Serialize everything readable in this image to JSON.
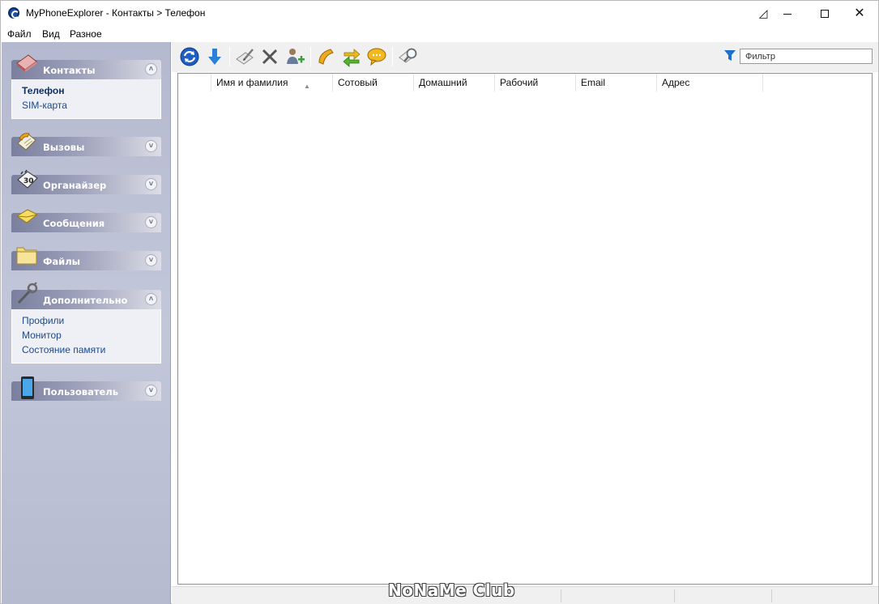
{
  "titlebar": {
    "title": "MyPhoneExplorer -  Контакты > Телефон",
    "minimize_icon": "minimize-icon",
    "maximize_icon": "maximize-icon",
    "close_icon": "close-icon"
  },
  "menu": {
    "items": [
      "Файл",
      "Вид",
      "Разное"
    ]
  },
  "sidebar": {
    "groups": [
      {
        "title": "Контакты",
        "icon": "address-book-icon",
        "expanded": true,
        "items": [
          "Телефон",
          "SIM-карта"
        ],
        "active": "Телефон"
      },
      {
        "title": "Вызовы",
        "icon": "call-log-icon",
        "expanded": false
      },
      {
        "title": "Органайзер",
        "icon": "organizer-icon",
        "expanded": false
      },
      {
        "title": "Сообщения",
        "icon": "messages-icon",
        "expanded": false
      },
      {
        "title": "Файлы",
        "icon": "folder-icon",
        "expanded": false
      },
      {
        "title": "Дополнительно",
        "icon": "tools-icon",
        "expanded": true,
        "items": [
          "Профили",
          "Монитор",
          "Состояние памяти"
        ]
      },
      {
        "title": "Пользователь",
        "icon": "phone-icon",
        "expanded": false
      }
    ]
  },
  "toolbar": {
    "buttons": [
      "refresh-icon",
      "download-icon",
      "edit-icon",
      "delete-icon",
      "add-contact-icon",
      "call-icon",
      "sync-icon",
      "message-icon",
      "find-duplicates-icon"
    ],
    "filter_placeholder": "Фильтр"
  },
  "grid": {
    "columns": [
      "Имя и фамилия",
      "Сотовый",
      "Домашний",
      "Рабочий",
      "Email",
      "Адрес"
    ],
    "sorted_column": "Имя и фамилия",
    "rows": []
  },
  "watermark": "NoNaMe Club",
  "colors": {
    "sidebar_bg": "#bcc0d4",
    "group_header": "#8a8fac",
    "link": "#1c4a8c",
    "toolbar_bg": "#f0f0f0"
  }
}
